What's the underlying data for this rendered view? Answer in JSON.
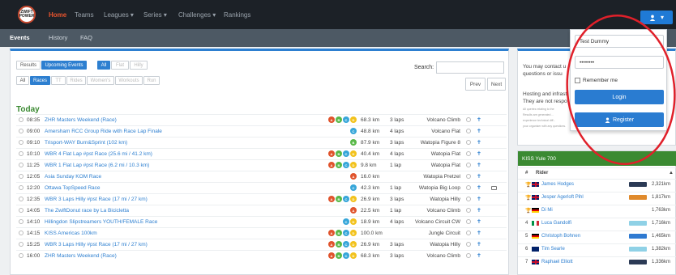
{
  "nav": {
    "logo_text": "ZWIFT POWER",
    "links": [
      "Home",
      "Teams",
      "Leagues ▾",
      "Series ▾",
      "Challenges ▾",
      "Rankings"
    ],
    "user_caret": "▾"
  },
  "subnav": [
    "Events",
    "History",
    "FAQ"
  ],
  "filters": {
    "view_tabs": [
      "Results",
      "Upcoming Events",
      "All",
      "Flat",
      "Hilly"
    ],
    "type_tabs": [
      "All",
      "Races",
      "TT",
      "Rides",
      "Women's",
      "Workouts",
      "Run"
    ],
    "search_label": "Search:",
    "prev": "Prev",
    "next": "Next"
  },
  "section_title": "Today",
  "events": [
    {
      "time": "08:35",
      "name": "ZHR Masters Weekend (Race)",
      "cats": [
        "A",
        "B",
        "C",
        "D"
      ],
      "dist": "68.3 km",
      "laps": "3 laps",
      "route": "Volcano Climb"
    },
    {
      "time": "09:00",
      "name": "Amersham RCC Group Ride with Race Lap Finale",
      "cats": [
        "C"
      ],
      "dist": "48.8 km",
      "laps": "4 laps",
      "route": "Volcano Flat"
    },
    {
      "time": "09:10",
      "name": "Trisport-WAY Burn&Sprint (102 km)",
      "cats": [
        "B"
      ],
      "dist": "87.9 km",
      "laps": "3 laps",
      "route": "Watopia Figure 8"
    },
    {
      "time": "10:10",
      "name": "WBR 4 Flat Lap #pst Race (25.6 mi / 41.2 km)",
      "cats": [
        "A",
        "B",
        "C",
        "D"
      ],
      "dist": "40.4 km",
      "laps": "4 laps",
      "route": "Watopia Flat"
    },
    {
      "time": "11:25",
      "name": "WBR 1 Flat Lap #pst Race (6.2 mi / 10.3 km)",
      "cats": [
        "A",
        "B",
        "C",
        "D"
      ],
      "dist": "9.8 km",
      "laps": "1 lap",
      "route": "Watopia Flat"
    },
    {
      "time": "12:05",
      "name": "Asia Sunday KOM Race",
      "cats": [
        "A"
      ],
      "dist": "16.0 km",
      "laps": "",
      "route": "Watopia Pretzel"
    },
    {
      "time": "12:20",
      "name": "Ottawa TopSpeed Race",
      "cats": [
        "C"
      ],
      "dist": "42.3 km",
      "laps": "1 lap",
      "route": "Watopia Big Loop"
    },
    {
      "time": "12:35",
      "name": "WBR 3 Laps Hilly #pst Race (17 mi / 27 km)",
      "cats": [
        "A",
        "B",
        "C",
        "D"
      ],
      "dist": "26.9 km",
      "laps": "3 laps",
      "route": "Watopia Hilly"
    },
    {
      "time": "14:05",
      "name": "The ZwiftDonut race by La Bicicletta",
      "cats": [
        "A"
      ],
      "dist": "22.5 km",
      "laps": "1 lap",
      "route": "Volcano Climb"
    },
    {
      "time": "14:10",
      "name": "Hillingdon Slipstreamers YOUTH/FEMALE Race",
      "cats": [
        "C",
        "D"
      ],
      "dist": "18.9 km",
      "laps": "4 laps",
      "route": "Volcano Circuit CW"
    },
    {
      "time": "14:15",
      "name": "KISS Americas 100km",
      "cats": [
        "A",
        "B",
        "C",
        "D"
      ],
      "dist": "100.0 km",
      "laps": "",
      "route": "Jungle Circuit"
    },
    {
      "time": "15:25",
      "name": "WBR 3 Laps Hilly #pst Race (17 mi / 27 km)",
      "cats": [
        "A",
        "B",
        "C",
        "D"
      ],
      "dist": "26.9 km",
      "laps": "3 laps",
      "route": "Watopia Hilly"
    },
    {
      "time": "16:00",
      "name": "ZHR Masters Weekend (Race)",
      "cats": [
        "A",
        "B",
        "C",
        "D"
      ],
      "dist": "68.3 km",
      "laps": "3 laps",
      "route": "Volcano Climb"
    }
  ],
  "side_panel": {
    "line1": "You may contact u",
    "line2": "questions or issu",
    "line3": "Hosting and infrast",
    "line4": "They are not respo",
    "small": [
      "All queries relating to the",
      "Results are generated ...",
      "experience technical diff...",
      "your organiser with any questions."
    ]
  },
  "kiss": {
    "title": "KISS Yule 700",
    "header": {
      "pos": "#",
      "rider": "Rider",
      "sort": "▲"
    },
    "rows": [
      {
        "pos": "🏆",
        "flag": "gb",
        "name": "James Hodges",
        "value": "2,321km",
        "bar": "#2b3a55"
      },
      {
        "pos": "🏆",
        "flag": "gb",
        "name": "Jesper Agerloft Pihl",
        "value": "1,817km",
        "bar": "#e08a2c"
      },
      {
        "pos": "🏆",
        "flag": "de",
        "name": "Di Mi",
        "value": "1,763km",
        "bar": ""
      },
      {
        "pos": "4",
        "flag": "it",
        "name": "Luca Gandolfi",
        "value": "1,716km",
        "bar": "#8fd1e6"
      },
      {
        "pos": "5",
        "flag": "de",
        "name": "Christoph Bohnen",
        "value": "1,465km",
        "bar": "#2f7ad1"
      },
      {
        "pos": "6",
        "flag": "au",
        "name": "Tim Searle",
        "value": "1,382km",
        "bar": "#8fd1e6"
      },
      {
        "pos": "7",
        "flag": "gb",
        "name": "Raphael Elliott",
        "value": "1,336km",
        "bar": "#2b3a55"
      }
    ]
  },
  "login": {
    "username": "Test Dummy",
    "password": "••••••••",
    "remember": "Remember me",
    "login_label": "Login",
    "register_label": "Register"
  },
  "colors": {
    "accent": "#2d7fd0",
    "nav_active": "#e8542e",
    "today": "#3b8a32",
    "annotation": "#e0202a"
  }
}
